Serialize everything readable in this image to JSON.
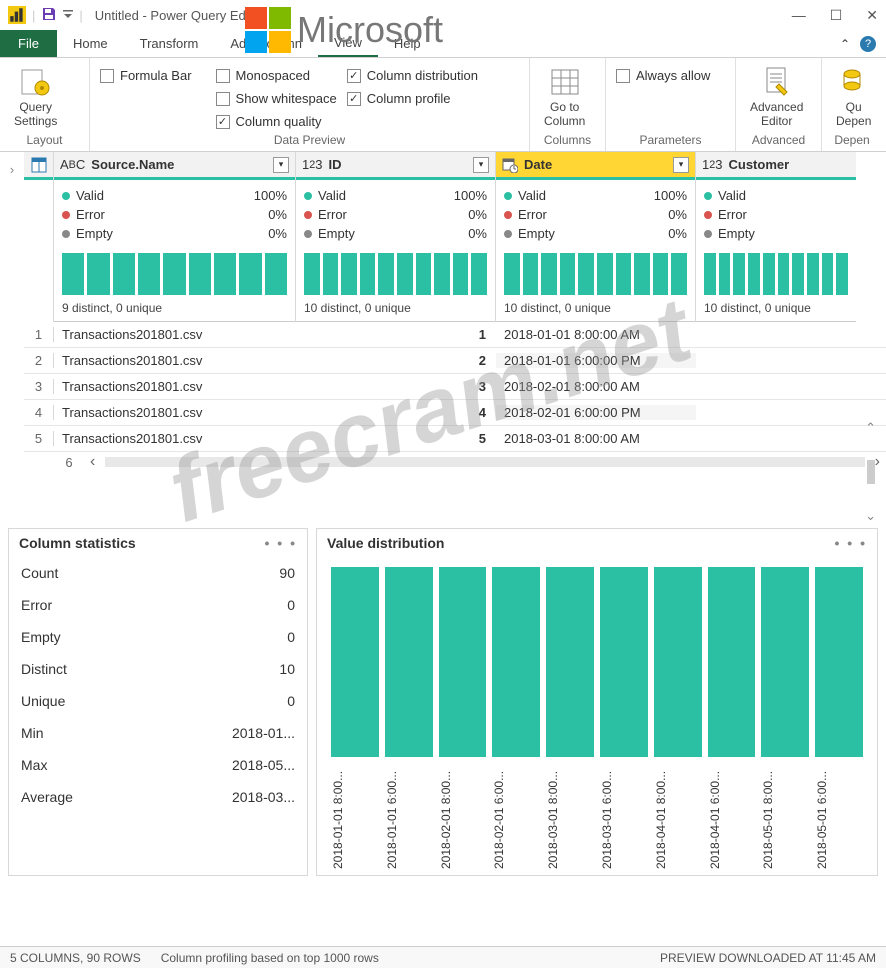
{
  "window": {
    "title": "Untitled - Power Query Editor"
  },
  "tabs": {
    "file": "File",
    "home": "Home",
    "transform": "Transform",
    "add": "Add Column",
    "view": "View",
    "help": "Help"
  },
  "ribbon": {
    "groups": {
      "layout": "Layout",
      "preview": "Data Preview",
      "columns": "Columns",
      "parameters": "Parameters",
      "advanced": "Advanced",
      "depen": "Depen"
    },
    "query_settings": "Query\nSettings",
    "formula_bar": "Formula Bar",
    "monospaced": "Monospaced",
    "show_ws": "Show whitespace",
    "col_quality": "Column quality",
    "col_dist": "Column distribution",
    "col_profile": "Column profile",
    "goto_col": "Go to\nColumn",
    "always_allow": "Always allow",
    "adv_editor": "Advanced\nEditor",
    "qu_depen": "Qu\nDepen"
  },
  "columns": [
    {
      "name": "Source.Name",
      "valid": "100%",
      "error": "0%",
      "empty": "0%",
      "dist": "9 distinct, 0 unique"
    },
    {
      "name": "ID",
      "valid": "100%",
      "error": "0%",
      "empty": "0%",
      "dist": "10 distinct, 0 unique"
    },
    {
      "name": "Date",
      "valid": "100%",
      "error": "0%",
      "empty": "0%",
      "dist": "10 distinct, 0 unique"
    },
    {
      "name": "Customer",
      "valid": "",
      "error": "",
      "empty": "",
      "dist": "10 distinct, 0 unique"
    }
  ],
  "quality_labels": {
    "valid": "Valid",
    "error": "Error",
    "empty": "Empty"
  },
  "rows": [
    {
      "n": "1",
      "src": "Transactions201801.csv",
      "id": "1",
      "date": "2018-01-01 8:00:00 AM"
    },
    {
      "n": "2",
      "src": "Transactions201801.csv",
      "id": "2",
      "date": "2018-01-01 6:00:00 PM"
    },
    {
      "n": "3",
      "src": "Transactions201801.csv",
      "id": "3",
      "date": "2018-02-01 8:00:00 AM"
    },
    {
      "n": "4",
      "src": "Transactions201801.csv",
      "id": "4",
      "date": "2018-02-01 6:00:00 PM"
    },
    {
      "n": "5",
      "src": "Transactions201801.csv",
      "id": "5",
      "date": "2018-03-01 8:00:00 AM"
    }
  ],
  "row6": "6",
  "stats": {
    "title": "Column statistics",
    "items": {
      "Count": "90",
      "Error": "0",
      "Empty": "0",
      "Distinct": "10",
      "Unique": "0",
      "Min": "2018-01...",
      "Max": "2018-05...",
      "Average": "2018-03..."
    }
  },
  "vd": {
    "title": "Value distribution",
    "labels": [
      "2018-01-01 8:00...",
      "2018-01-01 6:00...",
      "2018-02-01 8:00...",
      "2018-02-01 6:00...",
      "2018-03-01 8:00...",
      "2018-03-01 6:00...",
      "2018-04-01 8:00...",
      "2018-04-01 6:00...",
      "2018-05-01 8:00...",
      "2018-05-01 6:00..."
    ]
  },
  "status": {
    "left": "5 COLUMNS, 90 ROWS",
    "mid": "Column profiling based on top 1000 rows",
    "right": "PREVIEW DOWNLOADED AT 11:45 AM"
  },
  "watermark": {
    "ms": "Microsoft",
    "fc": "freecram.net"
  },
  "chart_data": {
    "type": "bar",
    "title": "Value distribution",
    "categories": [
      "2018-01-01 8:00",
      "2018-01-01 6:00",
      "2018-02-01 8:00",
      "2018-02-01 6:00",
      "2018-03-01 8:00",
      "2018-03-01 6:00",
      "2018-04-01 8:00",
      "2018-04-01 6:00",
      "2018-05-01 8:00",
      "2018-05-01 6:00"
    ],
    "values": [
      9,
      9,
      9,
      9,
      9,
      9,
      9,
      9,
      9,
      9
    ]
  }
}
